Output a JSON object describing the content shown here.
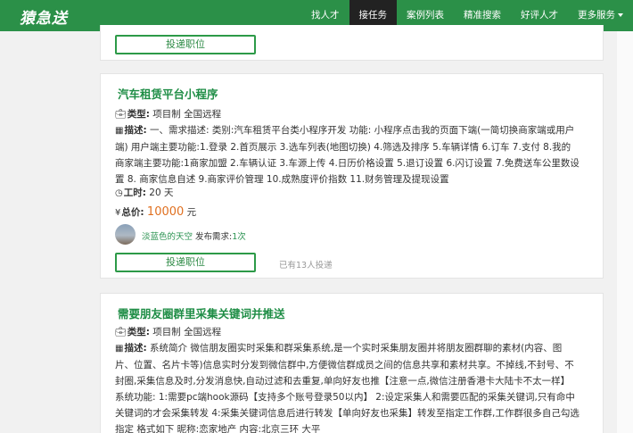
{
  "brand": "猿急送",
  "nav": [
    "找人才",
    "接任务",
    "案例列表",
    "精准搜索",
    "好评人才",
    "更多服务"
  ],
  "labels": {
    "apply": "投递职位",
    "type": "类型:",
    "desc": "描述:",
    "hours": "工时:",
    "total": "总价:",
    "posted": "发布需求:"
  },
  "jobs": [
    {
      "title": "汽车租赁平台小程序",
      "type": "项目制 全国远程",
      "desc": "一、需求描述:  类别:汽车租赁平台类小程序开发 功能:  小程序点击我的页面下端(一简切换商家端或用户端) 用户端主要功能:1.登录 2.首页展示 3.选车列表(地图切换) 4.筛选及排序 5.车辆详情 6.订车 7.支付 8.我的 商家端主要功能:1商家加盟 2.车辆认证 3.车源上传 4.日历价格设置 5.退订设置 6.闪订设置 7.免费送车公里数设置 8. 商家信息自述 9.商家评价管理 10.成熟度评价指数 11.财务管理及提现设置",
      "hours": "20 天",
      "price": "10000",
      "unit": "元",
      "user": "淡蓝色的天空",
      "posted_count": "1次",
      "applied": "已有13人投递"
    },
    {
      "title": "需要朋友圈群里采集关键词并推送",
      "type": "项目制 全国远程",
      "desc": "系统简介 微信朋友圈实时采集和群采集系统,是一个实时采集朋友圈并将朋友圈群聊的素材(内容、图片、位置、名片卡等)信息实时分发到微信群中,方便微信群成员之间的信息共享和素材共享。不掉线,不封号、不封圈,采集信息及时,分发消息快,自动过滤和去重复,单向好友也推【注意一点,微信注册香港卡大陆卡不太一样】 系统功能: 1:需要pc端hook源码【支持多个账号登录50以内】 2:设定采集人和需要匹配的采集关键词,只有命中关键词的才会采集转发 4:采集关键词信息后进行转发【单向好友也采集】转发至指定工作群,工作群很多自己勾选指定 格式如下 昵称:恋家地产 内容:北京三环 大平"
    }
  ]
}
